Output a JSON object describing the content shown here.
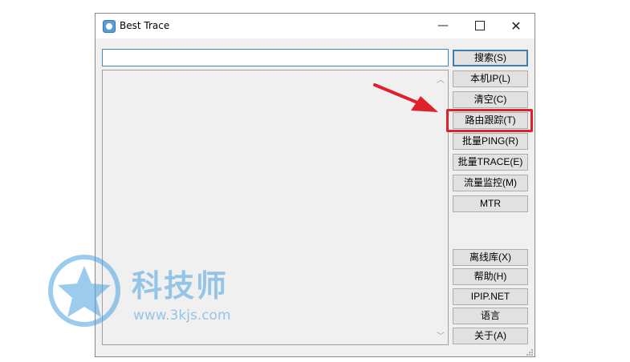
{
  "window": {
    "title": "Best Trace",
    "minimize_glyph": "—",
    "close_glyph": "✕"
  },
  "search": {
    "value": "",
    "placeholder": ""
  },
  "buttons": [
    {
      "label": "搜索(S)"
    },
    {
      "label": "本机IP(L)"
    },
    {
      "label": "清空(C)"
    },
    {
      "label": "路由跟踪(T)"
    },
    {
      "label": "批量PING(R)"
    },
    {
      "label": "批量TRACE(E)"
    },
    {
      "label": "流量监控(M)"
    },
    {
      "label": "MTR"
    },
    {
      "label": "离线库(X)"
    },
    {
      "label": "帮助(H)"
    },
    {
      "label": "IPIP.NET"
    },
    {
      "label": "语言"
    },
    {
      "label": "关于(A)"
    }
  ],
  "annotation": {
    "highlighted_button": "路由跟踪(T)",
    "color": "#e0202a"
  },
  "watermark": {
    "title": "科技师",
    "url": "www.3kjs.com"
  },
  "icons": {
    "app": "best-trace-app-icon",
    "scroll_up": "chevron-up-icon",
    "scroll_down": "chevron-down-icon"
  }
}
